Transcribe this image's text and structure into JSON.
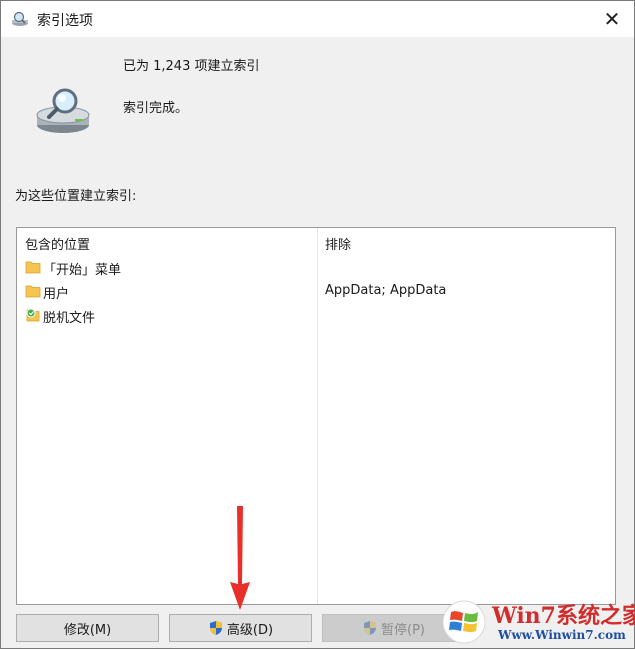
{
  "window": {
    "title": "索引选项",
    "close_glyph": "✕"
  },
  "status": {
    "count_text": "已为 1,243 项建立索引",
    "state_text": "索引完成。"
  },
  "locations": {
    "section_label": "为这些位置建立索引:",
    "columns": [
      "包含的位置",
      "排除"
    ],
    "rows": [
      {
        "name": "「开始」菜单",
        "exclude": "",
        "icon": "folder-icon"
      },
      {
        "name": "用户",
        "exclude": "AppData; AppData",
        "icon": "folder-icon"
      },
      {
        "name": "脱机文件",
        "exclude": "",
        "icon": "offline-files-icon"
      }
    ]
  },
  "buttons": {
    "modify": "修改(M)",
    "advanced": "高级(D)",
    "pause": "暂停(P)"
  },
  "watermark": {
    "brand": "Win7系统之家",
    "url": "Www.Winwin7.com"
  },
  "colors": {
    "accent_arrow": "#e8302b",
    "folder": "#f5c451",
    "brand_red": "#d12d2d",
    "brand_blue": "#1f4fa0"
  }
}
